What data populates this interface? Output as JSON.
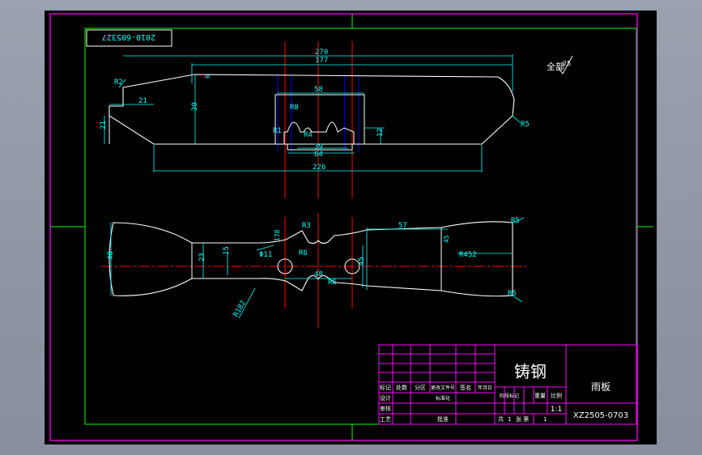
{
  "drawing": {
    "stamp_code": "2010-605327",
    "surface_note": "全部",
    "surface_symbol_value": "25",
    "colors": {
      "background": "#000000",
      "outline": "#ffffff",
      "dimension": "#00ffff",
      "centerline": "#ff0000",
      "hidden": "#0000ff",
      "border": "#00ff00",
      "title_block": "#ff00ff"
    }
  },
  "top_view": {
    "dims": {
      "overall": "270",
      "upper": "177",
      "slot_width": "58",
      "bottom_inner": "64",
      "bottom_mid": "39",
      "base": "226",
      "height": "30",
      "left_offset": "21",
      "left_height": "21",
      "right_height": "12",
      "small_six": "6",
      "r_left": "R2",
      "r_right": "R5",
      "r_slot": "R8",
      "r_inner": "R4",
      "r_bottom": "R1"
    }
  },
  "front_view": {
    "dims": {
      "height_left": "48",
      "neck": "23",
      "neck_inner": "15",
      "length_57": "57",
      "center_48": "48",
      "height_45": "45",
      "hole": "Φ11",
      "r_top": "R3",
      "r_mid": "R6",
      "r_low": "R6",
      "r_right": "R452",
      "r_right_top": "R5",
      "r_right_bot": "R5",
      "r_arc": "R182",
      "dim_78": "178",
      "dim_24": "45"
    }
  },
  "title_block": {
    "material": "铸钢",
    "part_name": "雨板",
    "scale": "1:1",
    "drawing_no": "XZ2505-0703",
    "h_labels": [
      "标记",
      "处数",
      "分区",
      "更改文件号",
      "签名",
      "年月日"
    ],
    "row2": [
      "设计",
      "",
      "标准化"
    ],
    "row3": [
      "审核"
    ],
    "row4": [
      "工艺",
      "",
      "批准"
    ],
    "stage_label": "阶段标记",
    "weight_label": "重量",
    "scale_label": "比例",
    "sheet_label": "共",
    "sheet_total": "1",
    "page_label": "张 第",
    "page_no": "1"
  }
}
